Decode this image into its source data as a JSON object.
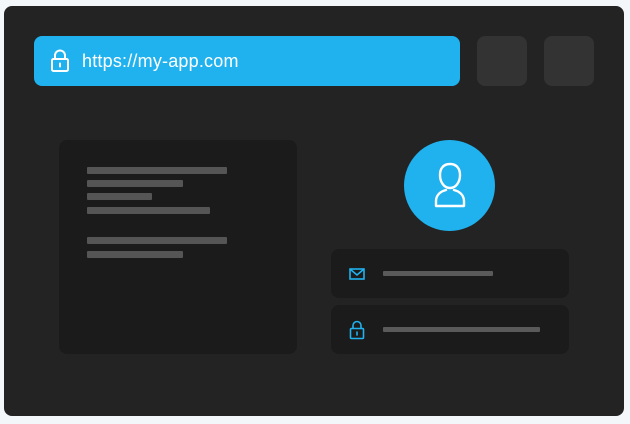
{
  "browser": {
    "url": "https://my-app.com",
    "lock_icon": "lock-icon",
    "accent_color": "#1fb2ef"
  },
  "login_form": {
    "avatar_icon": "user-icon",
    "email_field_icon": "mail-icon",
    "password_field_icon": "lock-icon"
  }
}
